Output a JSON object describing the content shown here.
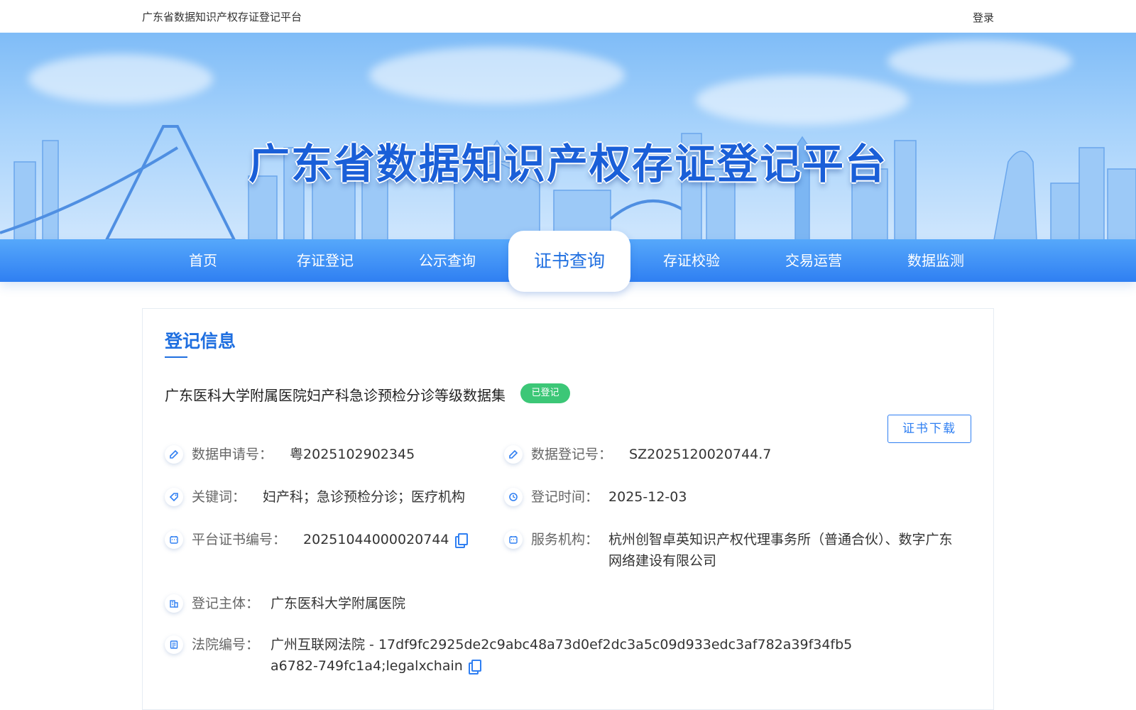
{
  "topbar": {
    "site_name": "广东省数据知识产权存证登记平台",
    "login_label": "登录"
  },
  "banner": {
    "title": "广东省数据知识产权存证登记平台"
  },
  "nav": {
    "items": [
      {
        "label": "首页"
      },
      {
        "label": "存证登记"
      },
      {
        "label": "公示查询"
      },
      {
        "label": "证书查询",
        "active": true
      },
      {
        "label": "存证校验"
      },
      {
        "label": "交易运营"
      },
      {
        "label": "数据监测"
      }
    ]
  },
  "card": {
    "section_title": "登记信息",
    "record_title": "广东医科大学附属医院妇产科急诊预检分诊等级数据集",
    "status_badge": "已登记",
    "download_label": "证书下载",
    "fields": {
      "application_no": {
        "label": "数据申请号：",
        "value": "粤2025102902345"
      },
      "registration_no": {
        "label": "数据登记号：",
        "value": "SZ2025120020744.7"
      },
      "keywords": {
        "label": "关键词：",
        "value": "妇产科；急诊预检分诊；医疗机构"
      },
      "registration_time": {
        "label": "登记时间：",
        "value": "2025-12-03"
      },
      "certificate_no": {
        "label": "平台证书编号：",
        "value": "20251044000020744"
      },
      "service_agency": {
        "label": "服务机构：",
        "value": "杭州创智卓英知识产权代理事务所（普通合伙）、数字广东网络建设有限公司"
      },
      "registrant": {
        "label": "登记主体：",
        "value": "广东医科大学附属医院"
      },
      "court_no": {
        "label": "法院编号：",
        "value": "广州互联网法院 - 17df9fc2925de2c9abc48a73d0ef2dc3a5c09d933edc3af782a39f34fb5a6782-749fc1a4;legalxchain"
      }
    }
  },
  "colors": {
    "accent": "#2f7ff2",
    "title_blue": "#1f6fe0",
    "badge_green": "#3cc777"
  }
}
